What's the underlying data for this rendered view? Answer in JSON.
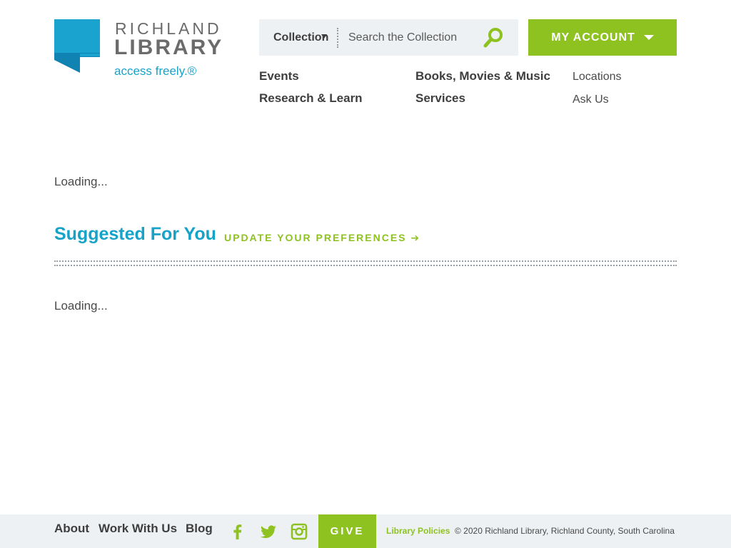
{
  "brand": {
    "name_line1": "RICHLAND",
    "name_line2": "LIBRARY",
    "tagline": "access freely.®"
  },
  "search": {
    "scope": "Collection",
    "placeholder": "Search the Collection",
    "button_icon": "magnifier-icon"
  },
  "account": {
    "label": "MY ACCOUNT",
    "icon": "caret-down-icon"
  },
  "nav": {
    "primary": [
      "Events",
      "Research & Learn",
      "Books, Movies & Music",
      "Services"
    ],
    "secondary": [
      "Locations",
      "Ask Us"
    ]
  },
  "main": {
    "loading_text_1": "Loading...",
    "suggested_title": "Suggested For You",
    "preferences_link": "UPDATE YOUR PREFERENCES ➔",
    "loading_text_2": "Loading..."
  },
  "footer": {
    "links": [
      "About",
      "Work With Us",
      "Blog"
    ],
    "social_icons": [
      "facebook-icon",
      "twitter-icon",
      "instagram-icon"
    ],
    "give_label": "GIVE",
    "policies_label": "Library Policies",
    "copyright": "© 2020 Richland Library, Richland County, South Carolina"
  },
  "colors": {
    "brand_blue": "#17a2c8",
    "brand_green": "#8dc221",
    "panel_gray": "#eef1f3",
    "text_dark": "#3e3e3e"
  }
}
